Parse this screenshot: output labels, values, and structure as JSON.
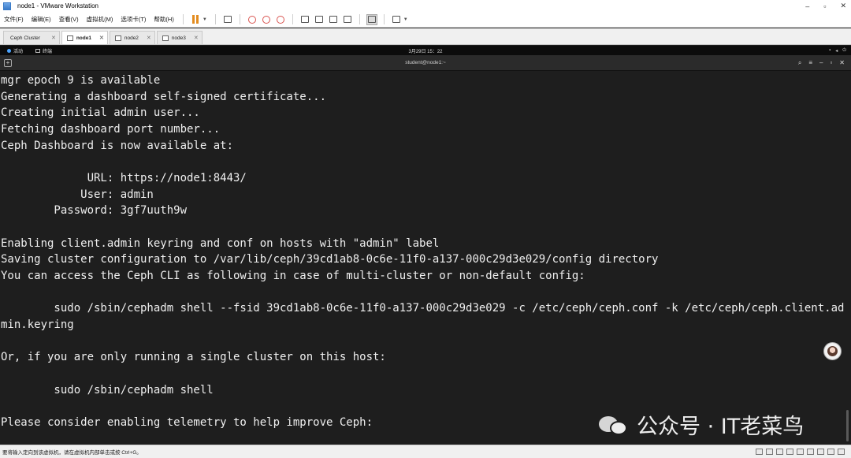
{
  "window": {
    "title": "node1 - VMware Workstation",
    "controls": [
      "–",
      "▫",
      "✕"
    ]
  },
  "menu": [
    "文件(F)",
    "编辑(E)",
    "查看(V)",
    "虚拟机(M)",
    "选项卡(T)",
    "帮助(H)"
  ],
  "tabs": [
    {
      "label": "Ceph Cluster",
      "active": false
    },
    {
      "label": "node1",
      "active": true
    },
    {
      "label": "node2",
      "active": false
    },
    {
      "label": "node3",
      "active": false
    }
  ],
  "gnome": {
    "activities": "活动",
    "app_menu": "终端",
    "clock": "3月29日  15：22"
  },
  "terminal": {
    "title": "student@node1:~",
    "lines": [
      "mgr epoch 9 is available",
      "Generating a dashboard self-signed certificate...",
      "Creating initial admin user...",
      "Fetching dashboard port number...",
      "Ceph Dashboard is now available at:",
      "",
      "             URL: https://node1:8443/",
      "            User: admin",
      "        Password: 3gf7uuth9w",
      "",
      "Enabling client.admin keyring and conf on hosts with \"admin\" label",
      "Saving cluster configuration to /var/lib/ceph/39cd1ab8-0c6e-11f0-a137-000c29d3e029/config directory",
      "You can access the Ceph CLI as following in case of multi-cluster or non-default config:",
      "",
      "        sudo /sbin/cephadm shell --fsid 39cd1ab8-0c6e-11f0-a137-000c29d3e029 -c /etc/ceph/ceph.conf -k /etc/ceph/ceph.client.ad",
      "min.keyring",
      "",
      "Or, if you are only running a single cluster on this host:",
      "",
      "        sudo /sbin/cephadm shell",
      "",
      "Please consider enabling telemetry to help improve Ceph:"
    ]
  },
  "watermark": "公众号 · IT老菜鸟",
  "status": {
    "message": "要将输入定向到该虚拟机，请在虚拟机内部单击或按 Ctrl+G。"
  }
}
